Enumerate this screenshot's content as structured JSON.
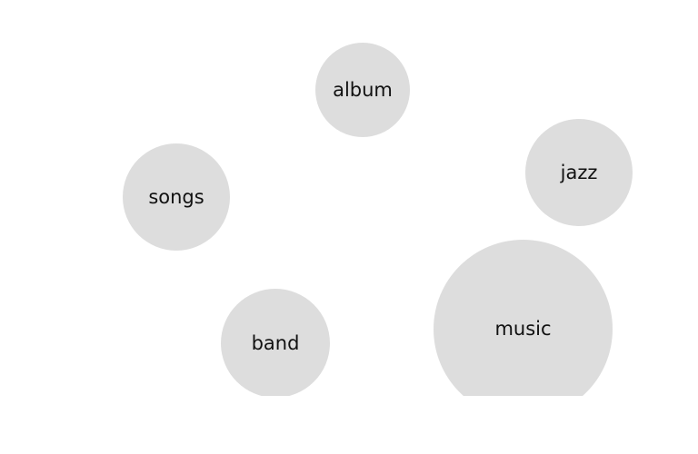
{
  "bubbles": [
    {
      "id": "album",
      "label": "album"
    },
    {
      "id": "jazz",
      "label": "jazz"
    },
    {
      "id": "songs",
      "label": "songs"
    },
    {
      "id": "band",
      "label": "band"
    },
    {
      "id": "music",
      "label": "music"
    }
  ],
  "style": {
    "background": "#ffffff",
    "bubble_fill": "#dddddd",
    "text_color": "#111111"
  }
}
